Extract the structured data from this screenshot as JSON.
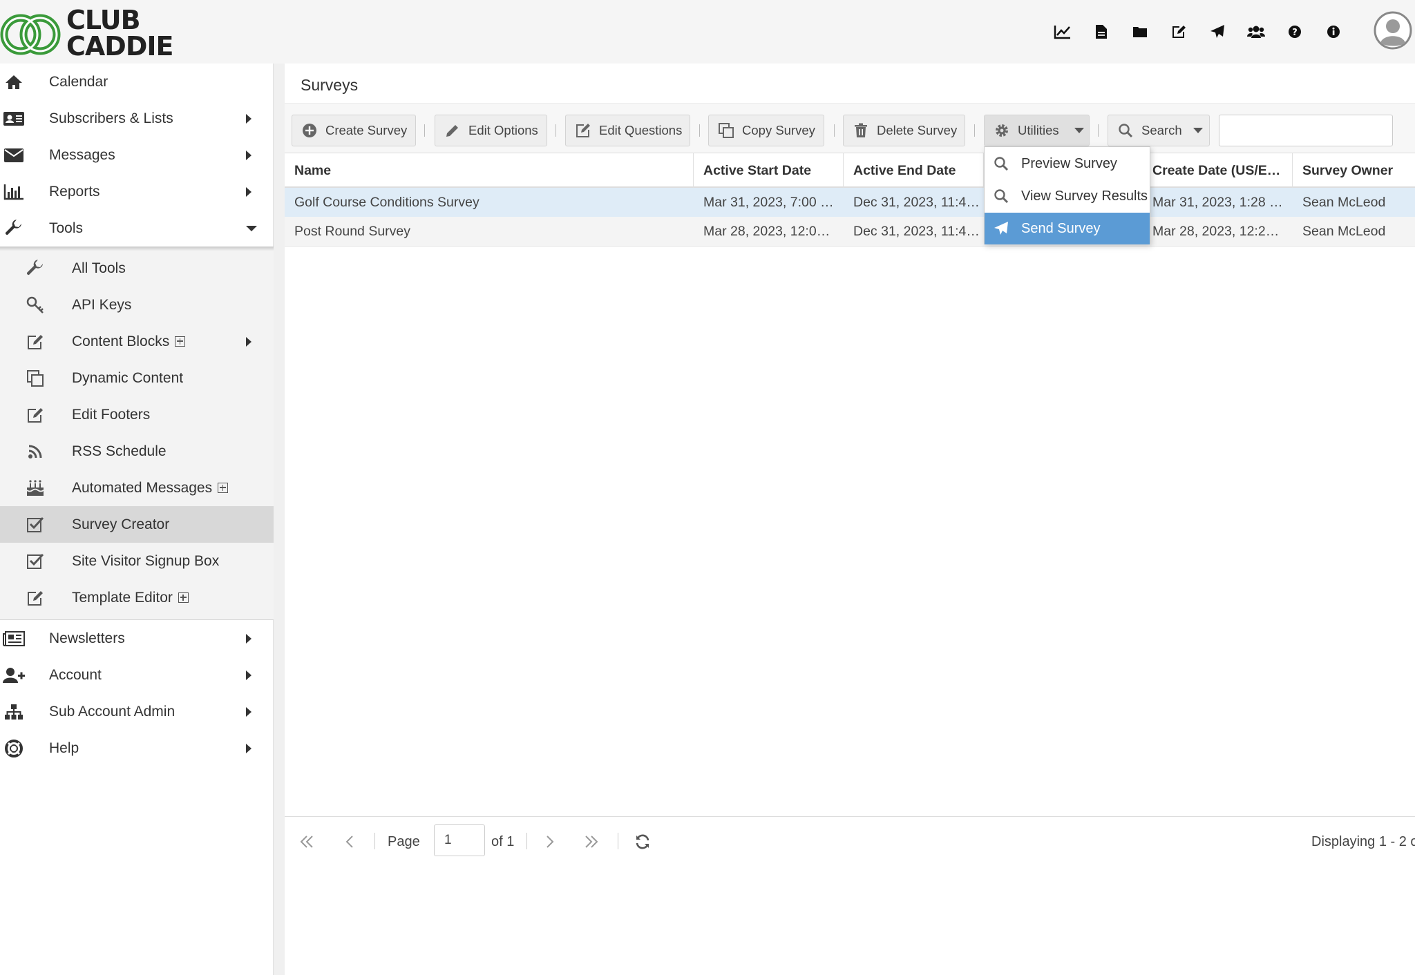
{
  "brand": {
    "line1": "CLUB",
    "line2": "CADDIE",
    "green": "#3a9a3a"
  },
  "header": {
    "icons": [
      "chart-line-icon",
      "document-icon",
      "folder-icon",
      "edit-icon",
      "paper-plane-icon",
      "users-icon",
      "question-icon",
      "info-icon"
    ],
    "avatar": "user-avatar-icon"
  },
  "sidebar": {
    "items": [
      {
        "label": "Calendar",
        "icon": "home-icon"
      },
      {
        "label": "Subscribers & Lists",
        "icon": "address-card-icon"
      },
      {
        "label": "Messages",
        "icon": "envelope-icon"
      },
      {
        "label": "Reports",
        "icon": "bar-chart-icon"
      },
      {
        "label": "Tools",
        "icon": "wrench-icon"
      }
    ],
    "tools_submenu": [
      {
        "label": "All Tools",
        "icon": "wrench-icon"
      },
      {
        "label": "API Keys",
        "icon": "key-icon"
      },
      {
        "label": "Content Blocks",
        "icon": "edit-icon"
      },
      {
        "label": "Dynamic Content",
        "icon": "copy-icon"
      },
      {
        "label": "Edit Footers",
        "icon": "edit-icon"
      },
      {
        "label": "RSS Schedule",
        "icon": "rss-icon"
      },
      {
        "label": "Automated Messages",
        "icon": "birthday-cake-icon"
      },
      {
        "label": "Survey Creator",
        "icon": "checkbox-icon"
      },
      {
        "label": "Site Visitor Signup Box",
        "icon": "checkbox-icon"
      },
      {
        "label": "Template Editor",
        "icon": "edit-icon"
      }
    ],
    "bottom_items": [
      {
        "label": "Newsletters",
        "icon": "newspaper-icon"
      },
      {
        "label": "Account",
        "icon": "user-plus-icon"
      },
      {
        "label": "Sub Account Admin",
        "icon": "sitemap-icon"
      },
      {
        "label": "Help",
        "icon": "life-ring-icon"
      }
    ]
  },
  "main": {
    "title": "Surveys",
    "toolbar": {
      "create": "Create Survey",
      "edit_options": "Edit Options",
      "edit_questions": "Edit Questions",
      "copy": "Copy Survey",
      "delete": "Delete Survey",
      "utilities": "Utilities",
      "search": "Search",
      "search_value": ""
    },
    "columns": [
      "Name",
      "Active Start Date",
      "Active End Date",
      "",
      "Create Date (US/E…",
      "Survey Owner"
    ],
    "rows": [
      {
        "name": "Golf Course Conditions Survey",
        "start": "Mar 31, 2023, 7:00 …",
        "end": "Dec 31, 2023, 11:4…",
        "created": "Mar 31, 2023, 1:28 …",
        "owner": "Sean McLeod"
      },
      {
        "name": "Post Round Survey",
        "start": "Mar 28, 2023, 12:0…",
        "end": "Dec 31, 2023, 11:4…",
        "created": "Mar 28, 2023, 12:2…",
        "owner": "Sean McLeod"
      }
    ],
    "utilities_menu": [
      {
        "label": "Preview Survey",
        "icon": "search-icon"
      },
      {
        "label": "View Survey Results",
        "icon": "search-icon"
      },
      {
        "label": "Send Survey",
        "icon": "paper-plane-icon"
      }
    ],
    "pager": {
      "page_label": "Page",
      "page_value": "1",
      "of_label": "of 1",
      "display": "Displaying 1 - 2 o"
    }
  },
  "colors": {
    "highlight": "#5b9bd5",
    "selected_row": "#dfecf7"
  }
}
